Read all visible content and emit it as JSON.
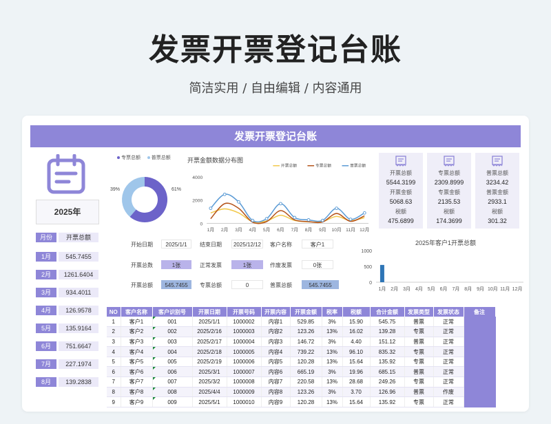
{
  "page": {
    "title": "发票开票登记台账",
    "subtitle": "简洁实用 / 自由编辑 / 内容通用"
  },
  "banner": {
    "title": "发票开票登记台账"
  },
  "year": "2025年",
  "month_table": {
    "header": [
      "月份",
      "开票总额"
    ],
    "rows": [
      [
        "1月",
        "545.7455"
      ],
      [
        "2月",
        "1261.6404"
      ],
      [
        "3月",
        "934.4011"
      ],
      [
        "4月",
        "126.9578"
      ],
      [
        "5月",
        "135.9164"
      ],
      [
        "6月",
        "751.6647"
      ],
      [
        "7月",
        "227.1974"
      ],
      [
        "8月",
        "139.2838"
      ]
    ]
  },
  "donut": {
    "legend": [
      "专票总额",
      "普票总额"
    ],
    "labels": [
      "39%",
      "61%"
    ],
    "colors": [
      "#6c63c9",
      "#9fc6ea"
    ]
  },
  "line_chart_title": "开票金额数据分布图",
  "kpis": [
    {
      "l1": "开票总额",
      "v1": "5544.3199",
      "l2": "开票金额",
      "v2": "5068.63",
      "l3": "税额",
      "v3": "475.6899"
    },
    {
      "l1": "专票总额",
      "v1": "2309.8999",
      "l2": "专票金额",
      "v2": "2135.53",
      "l3": "税额",
      "v3": "174.3699"
    },
    {
      "l1": "普票总额",
      "v1": "3234.42",
      "l2": "普票金额",
      "v2": "2933.1",
      "l3": "税额",
      "v3": "301.32"
    }
  ],
  "form": {
    "start_label": "开始日期",
    "start_value": "2025/1/1",
    "end_label": "结束日期",
    "end_value": "2025/12/12",
    "client_label": "客户名称",
    "client_value": "客户1",
    "total_count_label": "开票总数",
    "total_count_value": "1张",
    "normal_label": "正常发票",
    "normal_value": "1张",
    "void_label": "作废发票",
    "void_value": "0张",
    "total_amount_label": "开票总额",
    "total_amount_value": "545.7455",
    "special_label": "专票总额",
    "special_value": "0",
    "general_label": "普票总额",
    "general_value": "545.7455"
  },
  "bar_chart_title": "2025年客户1开票总额",
  "table": {
    "headers": [
      "NO",
      "客户名称",
      "客户识别号",
      "开票日期",
      "开票号码",
      "开票内容",
      "开票金额",
      "税率",
      "税额",
      "合计金额",
      "发票类型",
      "发票状态",
      "备注"
    ],
    "rows": [
      [
        "1",
        "客户1",
        "001",
        "2025/1/1",
        "1000002",
        "内容1",
        "529.85",
        "3%",
        "15.90",
        "545.75",
        "普票",
        "正常",
        ""
      ],
      [
        "2",
        "客户2",
        "002",
        "2025/2/16",
        "1000003",
        "内容2",
        "123.26",
        "13%",
        "16.02",
        "139.28",
        "专票",
        "正常",
        ""
      ],
      [
        "3",
        "客户3",
        "003",
        "2025/2/17",
        "1000004",
        "内容3",
        "146.72",
        "3%",
        "4.40",
        "151.12",
        "普票",
        "正常",
        ""
      ],
      [
        "4",
        "客户4",
        "004",
        "2025/2/18",
        "1000005",
        "内容4",
        "739.22",
        "13%",
        "96.10",
        "835.32",
        "专票",
        "正常",
        ""
      ],
      [
        "5",
        "客户5",
        "005",
        "2025/2/19",
        "1000006",
        "内容5",
        "120.28",
        "13%",
        "15.64",
        "135.92",
        "专票",
        "正常",
        ""
      ],
      [
        "6",
        "客户6",
        "006",
        "2025/3/1",
        "1000007",
        "内容6",
        "665.19",
        "3%",
        "19.96",
        "685.15",
        "普票",
        "正常",
        ""
      ],
      [
        "7",
        "客户7",
        "007",
        "2025/3/2",
        "1000008",
        "内容7",
        "220.58",
        "13%",
        "28.68",
        "249.26",
        "专票",
        "正常",
        ""
      ],
      [
        "8",
        "客户8",
        "008",
        "2025/4/4",
        "1000009",
        "内容8",
        "123.26",
        "3%",
        "3.70",
        "126.96",
        "普票",
        "作废",
        ""
      ],
      [
        "9",
        "客户9",
        "009",
        "2025/5/1",
        "1000010",
        "内容9",
        "120.28",
        "13%",
        "15.64",
        "135.92",
        "专票",
        "正常",
        ""
      ]
    ]
  },
  "chart_data": [
    {
      "type": "line",
      "title": "开票金额数据分布图",
      "categories": [
        "1月",
        "2月",
        "3月",
        "4月",
        "5月",
        "6月",
        "7月",
        "8月",
        "9月",
        "10月",
        "11月",
        "12月"
      ],
      "ylim": [
        0,
        4000
      ],
      "yticks": [
        "4000",
        "2000",
        "0"
      ],
      "series": [
        {
          "name": "开票总额",
          "color": "#f2c94c",
          "values": [
            900,
            1250,
            900,
            150,
            200,
            700,
            250,
            130,
            150,
            600,
            230,
            500
          ]
        },
        {
          "name": "专票总额",
          "color": "#b5541b",
          "values": [
            400,
            1700,
            1300,
            100,
            150,
            1100,
            300,
            150,
            120,
            850,
            180,
            650
          ]
        },
        {
          "name": "普票总额",
          "color": "#5b9bd5",
          "values": [
            1300,
            2500,
            1850,
            250,
            400,
            1700,
            500,
            300,
            250,
            1300,
            350,
            900
          ]
        }
      ]
    },
    {
      "type": "bar",
      "title": "2025年客户1开票总额",
      "categories": [
        "1月",
        "2月",
        "3月",
        "4月",
        "5月",
        "6月",
        "7月",
        "8月",
        "9月",
        "10月",
        "11月",
        "12月"
      ],
      "values": [
        545.7455,
        0,
        0,
        0,
        0,
        0,
        0,
        0,
        0,
        0,
        0,
        0
      ],
      "ylim": [
        0,
        1000
      ],
      "yticks": [
        "1000",
        "500",
        "0"
      ],
      "color": "#2e75b6"
    }
  ]
}
